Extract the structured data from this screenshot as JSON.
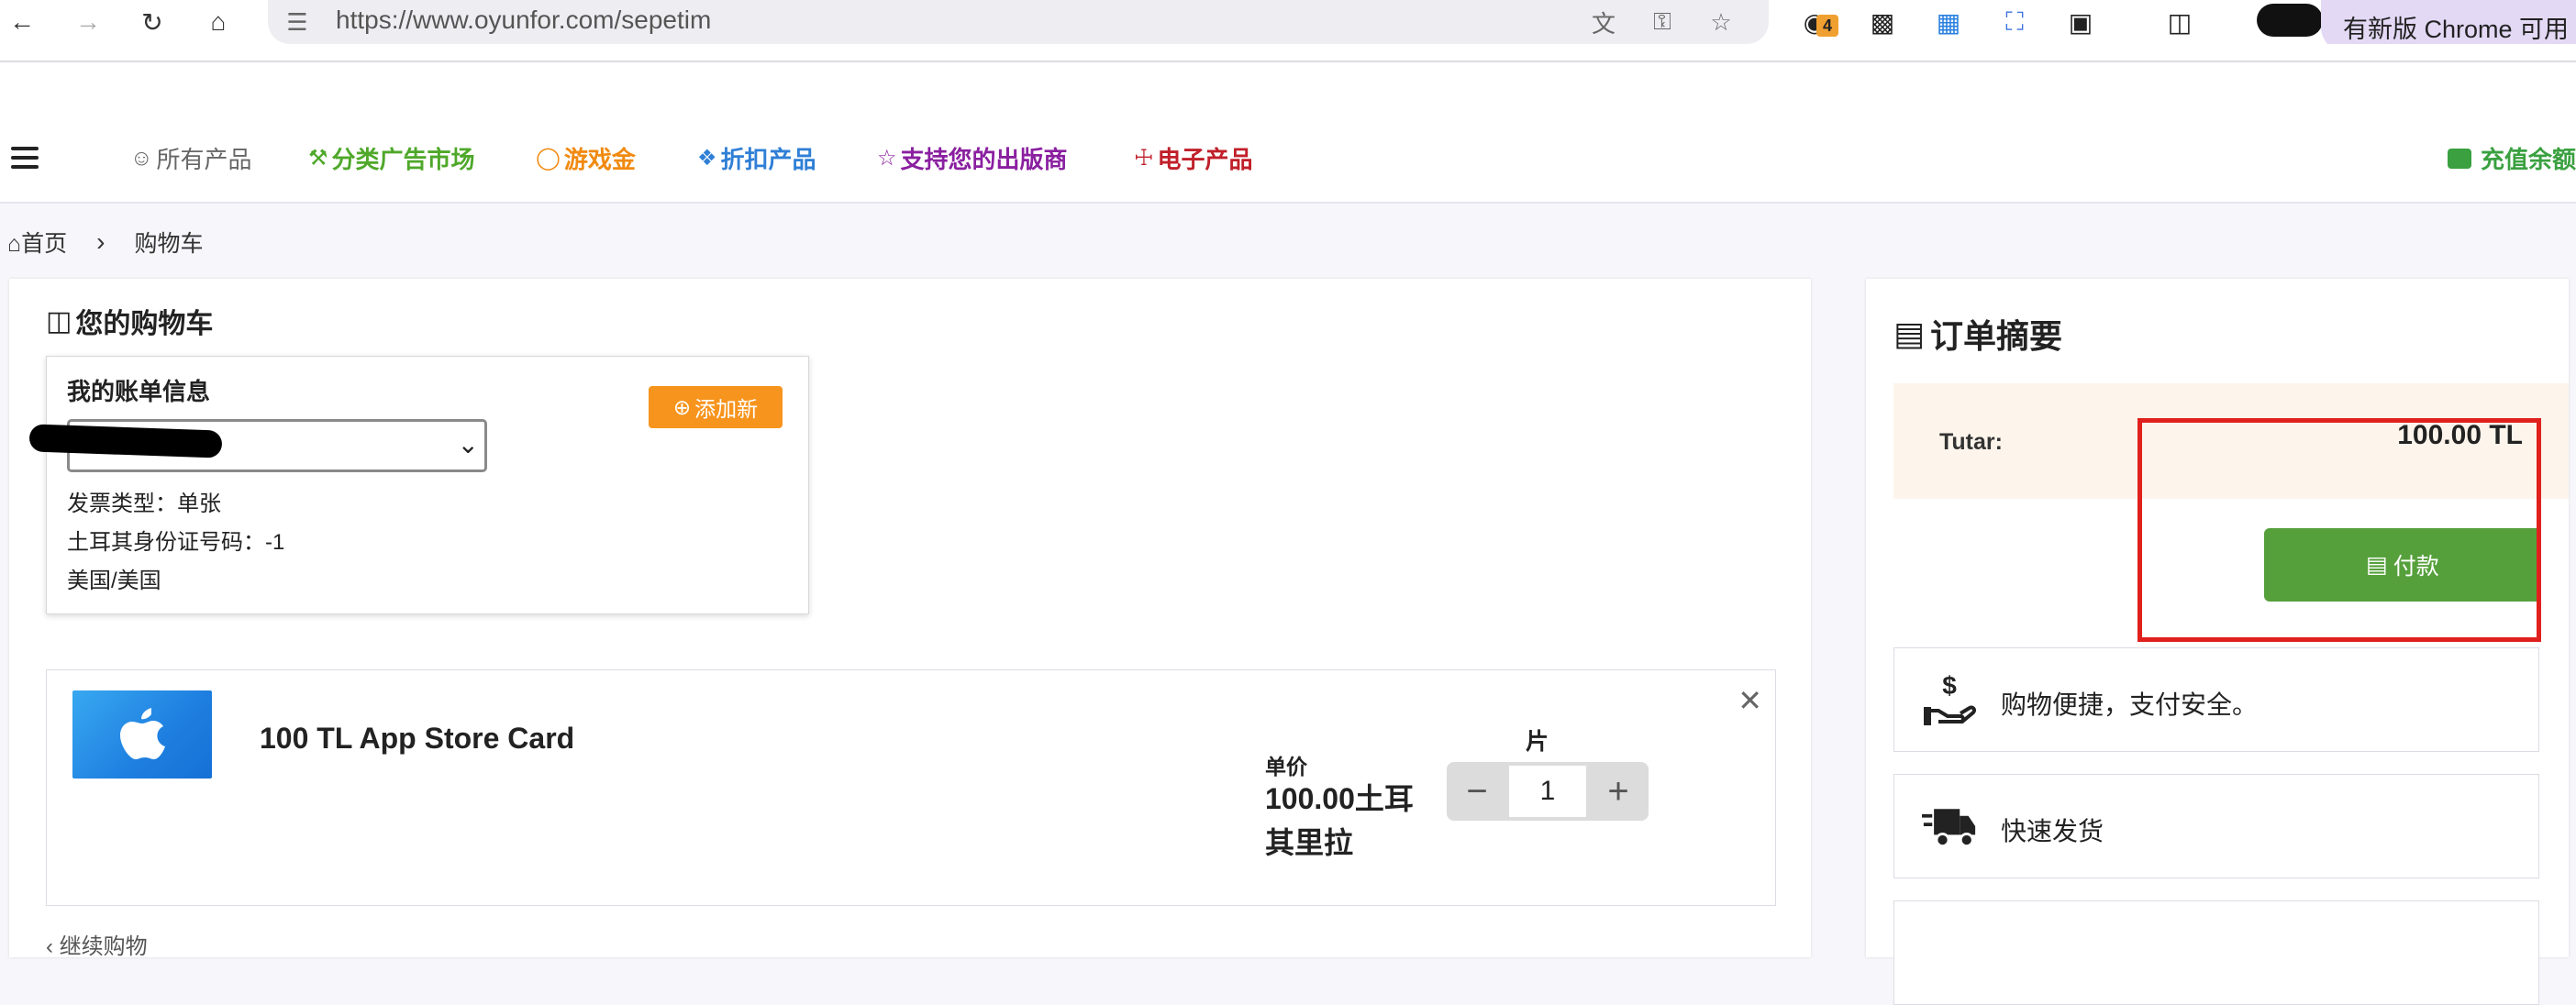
{
  "browser": {
    "url": "https://www.oyunfor.com/sepetim",
    "extension_badge": "4",
    "update_label": "有新版 Chrome 可用"
  },
  "nav": {
    "items": [
      {
        "label": "所有产品",
        "icon": "users-icon",
        "color": "#666666"
      },
      {
        "label": "分类广告市场",
        "icon": "wrench-icon",
        "color": "#4fa82a"
      },
      {
        "label": "游戏金",
        "icon": "gamepad-icon",
        "color": "#f08a10"
      },
      {
        "label": "折扣产品",
        "icon": "tag-icon",
        "color": "#2f7fd6"
      },
      {
        "label": "支持您的出版商",
        "icon": "star-icon",
        "color": "#8a1fa0"
      },
      {
        "label": "电子产品",
        "icon": "coins-icon",
        "color": "#c0202a"
      }
    ],
    "topup_label": "充值余额"
  },
  "breadcrumb": {
    "home": "首页",
    "current": "购物车"
  },
  "cart": {
    "title": "您的购物车",
    "billing": {
      "title": "我的账单信息",
      "add_new_label": "添加新",
      "invoice_type": "发票类型：单张",
      "tax_id": "土耳其身份证号码：-1",
      "location": "美国/美国"
    },
    "item": {
      "name": "100 TL App Store Card",
      "unit_label": "单价",
      "unit_price": "100.00土耳其里拉",
      "qty_label": "片",
      "quantity": "1"
    },
    "continue_label": "继续购物"
  },
  "summary": {
    "title": "订单摘要",
    "total_label": "Tutar:",
    "total_value": "100.00 TL",
    "pay_label": "付款",
    "features": [
      {
        "text": "购物便捷，支付安全。",
        "icon": "hand-money-icon"
      },
      {
        "text": "快速发货",
        "icon": "truck-icon"
      }
    ]
  }
}
